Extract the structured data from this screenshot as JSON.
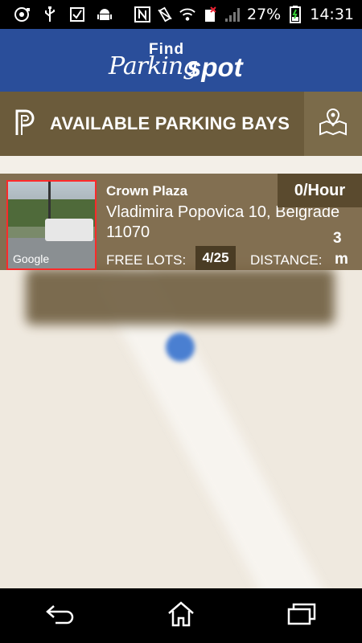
{
  "status_bar": {
    "battery_percent": "27%",
    "time": "14:31",
    "icons": [
      "record-icon",
      "usb-icon",
      "checkbox-icon",
      "android-icon",
      "nfc-icon",
      "vibrate-icon",
      "wifi-icon",
      "sim-icon",
      "signal-icon",
      "battery-icon"
    ]
  },
  "header": {
    "logo_find": "Find",
    "logo_parking": "Parking",
    "logo_spot": "spot",
    "brand_color": "#2a4e9a"
  },
  "section": {
    "title": "AVAILABLE PARKING BAYS",
    "icon": "parking-p-icon",
    "map_button_icon": "map-pin-icon",
    "bar_color": "#6b5b3b"
  },
  "parking_card": {
    "name": "Crown Plaza",
    "address_line1": "Vladimira Popovica 10, Belgrade",
    "address_line2": "11070",
    "price": "0/Hour",
    "free_lots_label": "FREE LOTS:",
    "free_lots_value": "4/25",
    "distance_label": "DISTANCE:",
    "distance_value": "3",
    "distance_unit": "m",
    "thumbnail_caption": "Google"
  },
  "nav": {
    "back_icon": "back-icon",
    "home_icon": "home-icon",
    "recents_icon": "recents-icon"
  }
}
